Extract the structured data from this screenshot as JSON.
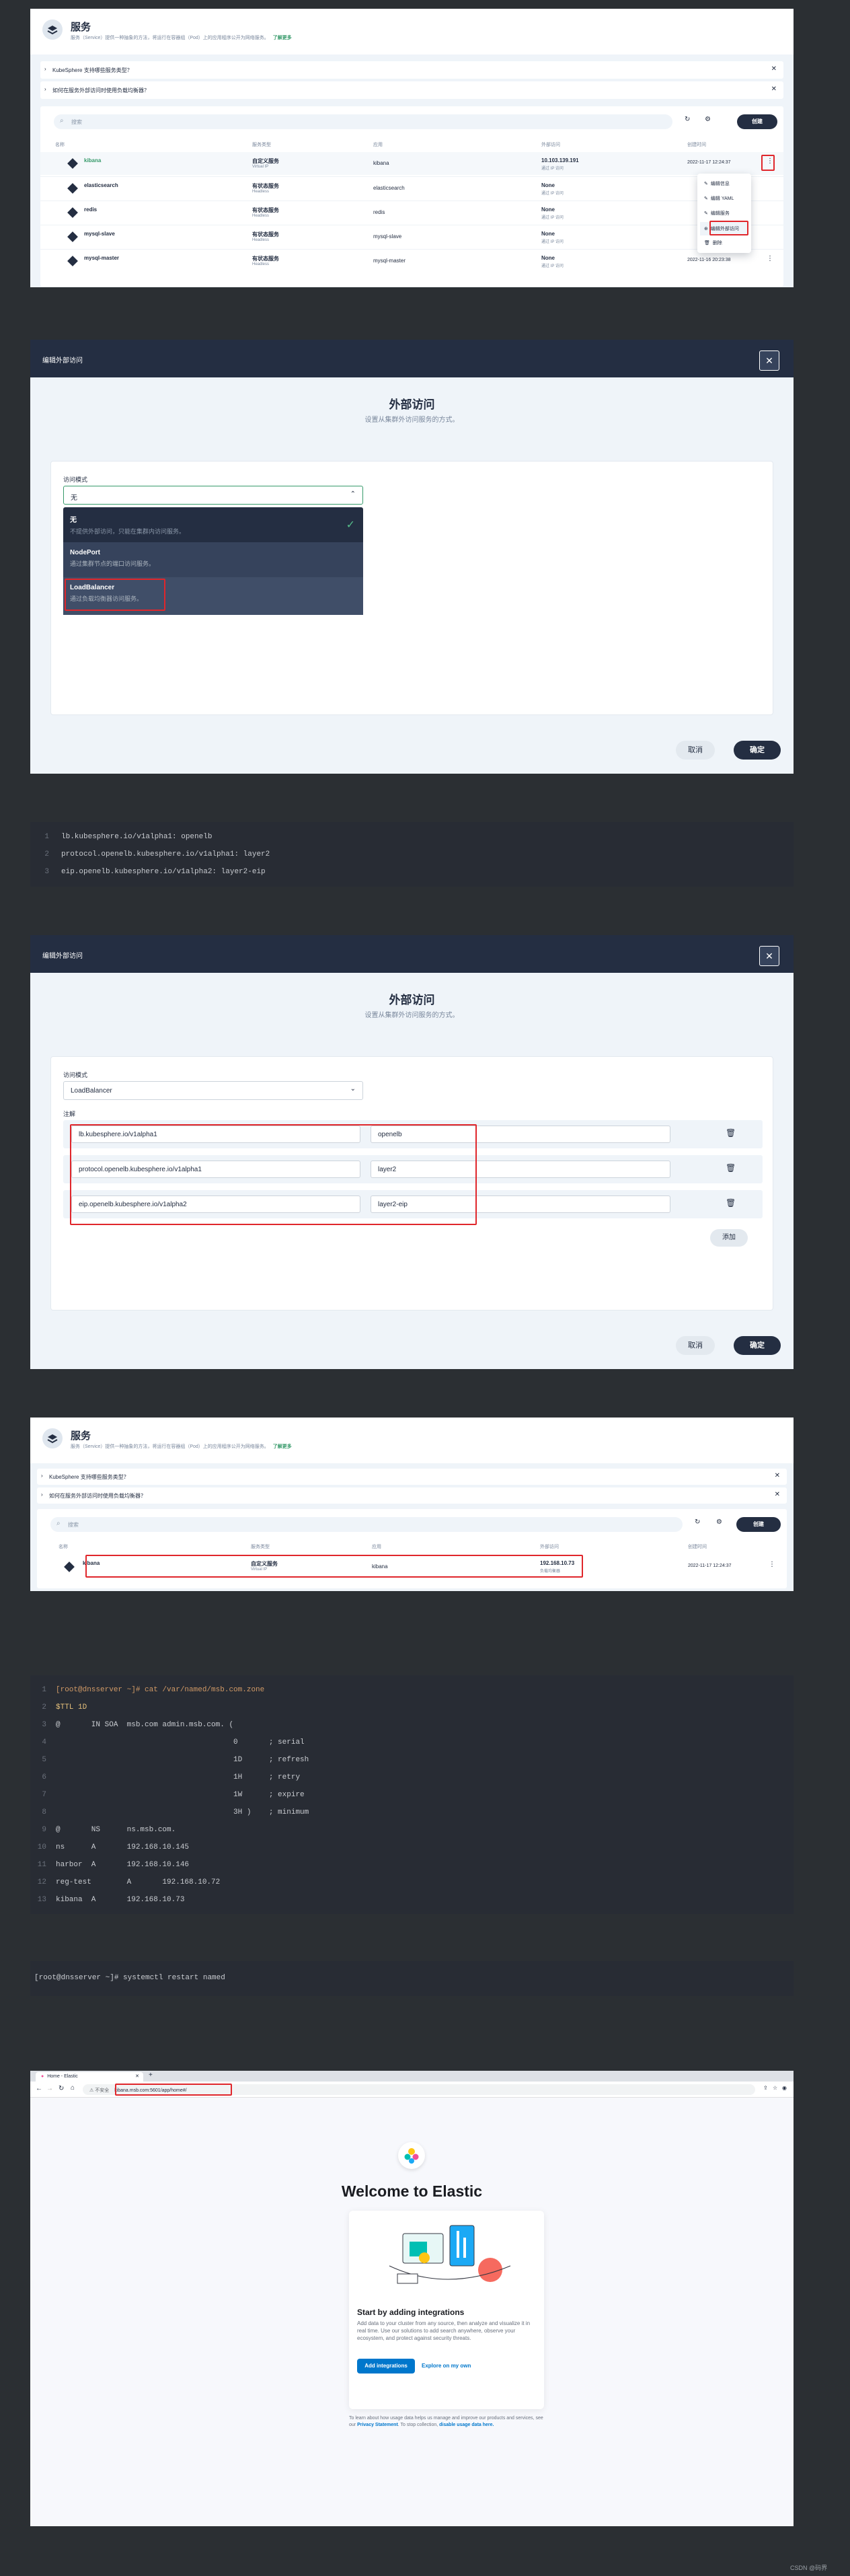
{
  "shot1": {
    "title": "服务",
    "desc": "服务（Service）提供一种抽象的方法，将运行在容器组（Pod）上的应用程序公开为网络服务。",
    "learn_more": "了解更多",
    "notice1": "KubeSphere 支持哪些服务类型？",
    "notice2": "如何在服务外部访问时使用负载均衡器？",
    "search_placeholder": "搜索",
    "create": "创建",
    "headers": [
      "名称",
      "服务类型",
      "应用",
      "外部访问",
      "创建时间"
    ],
    "rows": [
      {
        "name": "kibana",
        "sub": "",
        "type": "自定义服务",
        "typesub": "Virtual IP",
        "app": "kibana",
        "ext": "10.103.139.191",
        "extsub": "通过 IP 访问",
        "time": "2022-11-17 12:24:37"
      },
      {
        "name": "elasticsearch",
        "sub": "",
        "type": "有状态服务",
        "typesub": "Headless",
        "app": "elasticsearch",
        "ext": "None",
        "extsub": "通过 IP 访问",
        "time": ""
      },
      {
        "name": "redis",
        "sub": "",
        "type": "有状态服务",
        "typesub": "Headless",
        "app": "redis",
        "ext": "None",
        "extsub": "通过 IP 访问",
        "time": ""
      },
      {
        "name": "mysql-slave",
        "sub": "",
        "type": "有状态服务",
        "typesub": "Headless",
        "app": "mysql-slave",
        "ext": "None",
        "extsub": "通过 IP 访问",
        "time": ""
      },
      {
        "name": "mysql-master",
        "sub": "",
        "type": "有状态服务",
        "typesub": "Headless",
        "app": "mysql-master",
        "ext": "None",
        "extsub": "通过 IP 访问",
        "time": "2022-11-16 20:23:38"
      }
    ],
    "menu": [
      "编辑信息",
      "编辑 YAML",
      "编辑服务",
      "编辑外部访问",
      "删除"
    ]
  },
  "shot2": {
    "header": "编辑外部访问",
    "title": "外部访问",
    "subtitle": "设置从集群外访问服务的方式。",
    "mode_label": "访问模式",
    "selected": "无",
    "options": [
      {
        "title": "无",
        "desc": "不提供外部访问，只能在集群内访问服务。"
      },
      {
        "title": "NodePort",
        "desc": "通过集群节点的端口访问服务。"
      },
      {
        "title": "LoadBalancer",
        "desc": "通过负载均衡器访问服务。"
      }
    ],
    "cancel": "取消",
    "ok": "确定"
  },
  "code1": {
    "lines": [
      {
        "no": "1",
        "text": "lb.kubesphere.io/v1alpha1: openelb"
      },
      {
        "no": "2",
        "text": "protocol.openelb.kubesphere.io/v1alpha1: layer2"
      },
      {
        "no": "3",
        "text": "eip.openelb.kubesphere.io/v1alpha2: layer2-eip"
      }
    ]
  },
  "shot3": {
    "header": "编辑外部访问",
    "title": "外部访问",
    "subtitle": "设置从集群外访问服务的方式。",
    "mode_label": "访问模式",
    "selected": "LoadBalancer",
    "annot_label": "注解",
    "annotations": [
      {
        "key": "lb.kubesphere.io/v1alpha1",
        "value": "openelb"
      },
      {
        "key": "protocol.openelb.kubesphere.io/v1alpha1",
        "value": "layer2"
      },
      {
        "key": "eip.openelb.kubesphere.io/v1alpha2",
        "value": "layer2-eip"
      }
    ],
    "add": "添加",
    "cancel": "取消",
    "ok": "确定"
  },
  "shot4": {
    "title": "服务",
    "desc": "服务（Service）提供一种抽象的方法，将运行在容器组（Pod）上的应用程序公开为网络服务。",
    "learn_more": "了解更多",
    "notice1": "KubeSphere 支持哪些服务类型？",
    "notice2": "如何在服务外部访问时使用负载均衡器？",
    "search_placeholder": "搜索",
    "create": "创建",
    "headers": [
      "名称",
      "服务类型",
      "应用",
      "外部访问",
      "创建时间"
    ],
    "row": {
      "name": "kibana",
      "type": "自定义服务",
      "typesub": "Virtual IP",
      "app": "kibana",
      "ext": "192.168.10.73",
      "extsub": "负载均衡器",
      "time": "2022-11-17 12:24:37"
    }
  },
  "code2": {
    "lines": [
      {
        "no": "1",
        "text": "[root@dnsserver ~]# cat /var/named/msb.com.zone"
      },
      {
        "no": "2",
        "text": "$TTL 1D"
      },
      {
        "no": "3",
        "text": "@       IN SOA  msb.com admin.msb.com. ("
      },
      {
        "no": "4",
        "text": "                                        0       ; serial"
      },
      {
        "no": "5",
        "text": "                                        1D      ; refresh"
      },
      {
        "no": "6",
        "text": "                                        1H      ; retry"
      },
      {
        "no": "7",
        "text": "                                        1W      ; expire"
      },
      {
        "no": "8",
        "text": "                                        3H )    ; minimum"
      },
      {
        "no": "9",
        "text": "@       NS      ns.msb.com."
      },
      {
        "no": "10",
        "text": "ns      A       192.168.10.145"
      },
      {
        "no": "11",
        "text": "harbor  A       192.168.10.146"
      },
      {
        "no": "12",
        "text": "reg-test        A       192.168.10.72"
      },
      {
        "no": "13",
        "text": "kibana  A       192.168.10.73"
      }
    ]
  },
  "code3": {
    "line": "[root@dnsserver ~]# systemctl restart named"
  },
  "browser": {
    "tab": "Home - Elastic",
    "insecure": "不安全",
    "url": "kibana.msb.com:5601/app/home#/",
    "welcome": "Welcome to Elastic",
    "card_title": "Start by adding integrations",
    "card_desc": "Add data to your cluster from any source, then analyze and visualize it in real time. Use our solutions to add search anywhere, observe your ecosystem, and protect against security threats.",
    "btn_add": "Add integrations",
    "btn_explore": "Explore on my own",
    "footer1": "To learn about how usage data helps us manage and improve our products and services, see our",
    "privacy": "Privacy Statement",
    "footer2": "To stop collection,",
    "disable": "disable usage data here."
  },
  "watermark": "CSDN @码界"
}
